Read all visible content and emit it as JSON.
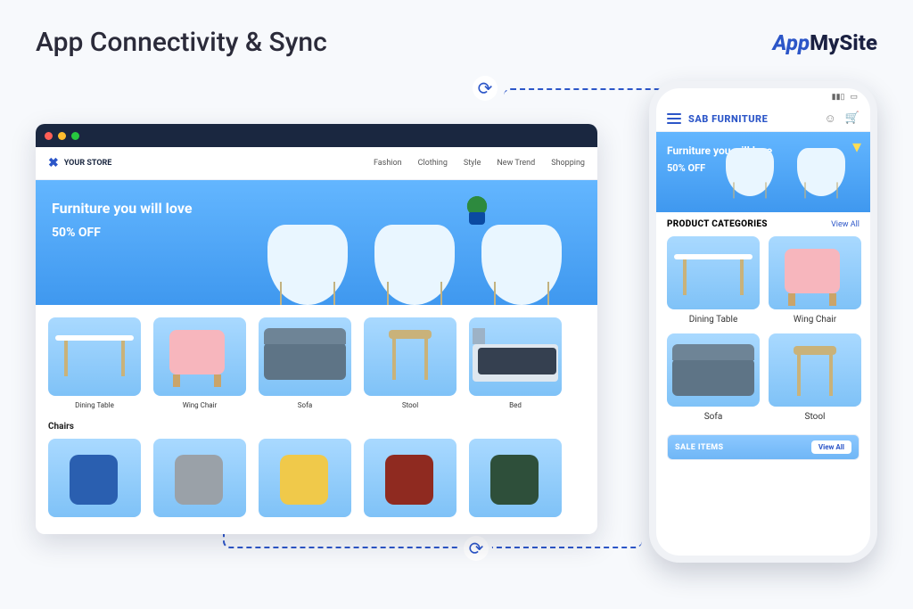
{
  "page": {
    "title": "App Connectivity & Sync"
  },
  "brand": {
    "part1": "App",
    "part2": "My",
    "part3": "Site"
  },
  "desktop": {
    "store_name": "YOUR STORE",
    "nav": {
      "n0": "Fashion",
      "n1": "Clothing",
      "n2": "Style",
      "n3": "New Trend",
      "n4": "Shopping"
    },
    "hero": {
      "headline": "Furniture you will love",
      "discount": "50% OFF"
    },
    "categories": {
      "c0": "Dining Table",
      "c1": "Wing Chair",
      "c2": "Sofa",
      "c3": "Stool",
      "c4": "Bed"
    },
    "section2": "Chairs"
  },
  "phone": {
    "status": {
      "signal": "▮▮▯",
      "batt": "▭"
    },
    "app_title": "SAB FURNITURE",
    "hero": {
      "headline": "Furniture you will love",
      "discount": "50% OFF"
    },
    "pc_label": "PRODUCT CATEGORIES",
    "view_all": "View All",
    "grid": {
      "g0": "Dining Table",
      "g1": "Wing Chair",
      "g2": "Sofa",
      "g3": "Stool"
    },
    "sale_label": "SALE ITEMS",
    "sale_btn": "View All"
  }
}
